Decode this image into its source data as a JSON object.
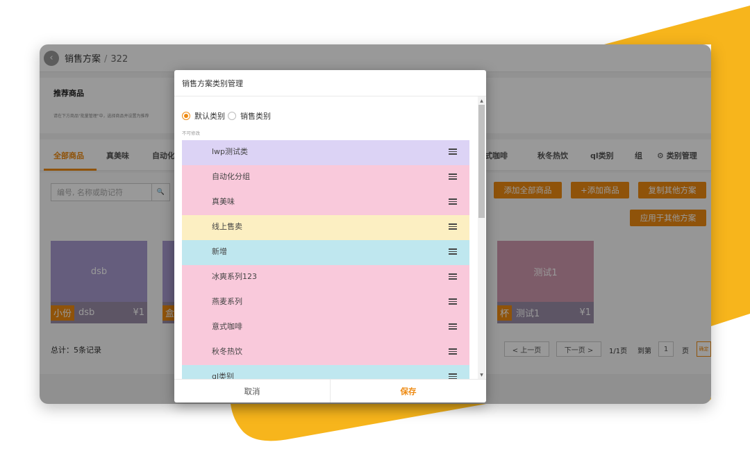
{
  "colors": {
    "accent": "#ee8a12",
    "decor_yellow": "#f7b51c",
    "row_purple": "#dcd3f5",
    "row_pink": "#f9c9db",
    "row_yellow": "#fcefc2",
    "row_cyan": "#bfe7ef"
  },
  "header": {
    "breadcrumb_parent": "销售方案",
    "breadcrumb_separator": "/",
    "breadcrumb_current": "322",
    "back_icon": "chevron-left-icon"
  },
  "recommend": {
    "title": "推荐商品",
    "description": "请在下方商品\"批量管理\"中，选择商品并设置为推荐"
  },
  "tabs": [
    {
      "label": "全部商品"
    },
    {
      "label": "真美味"
    },
    {
      "label": "自动化"
    },
    {
      "label": "意式咖啡"
    },
    {
      "label": "秋冬热饮"
    },
    {
      "label": "ql类别"
    },
    {
      "label": "组"
    },
    {
      "label": "类别管理"
    }
  ],
  "search": {
    "placeholder": "编号, 名称或助记符",
    "icon": "search-icon"
  },
  "actions": {
    "add_all": "添加全部商品",
    "add_product": "+添加商品",
    "copy_other": "复制其他方案",
    "apply_other": "应用于其他方案"
  },
  "cards": [
    {
      "image_text": "dsb",
      "tag": "小份",
      "name": "dsb",
      "price": "¥1",
      "color": "#a89bd0"
    },
    {
      "image_text": "",
      "tag": "盒",
      "name": "",
      "price": "",
      "color": "#a89bd0"
    },
    {
      "image_text": "测试1",
      "tag": "杯",
      "name": "测试1",
      "price": "¥1",
      "color": "#d19aaf"
    }
  ],
  "footer": {
    "total": "总计：5条记录",
    "prev": "< 上一页",
    "next": "下一页 >",
    "page_info": "1/1页",
    "goto": "到第",
    "page_value": "1",
    "page_unit": "页",
    "confirm": "确定"
  },
  "modal": {
    "title": "销售方案类别管理",
    "radio_default": "默认类别",
    "radio_sales": "销售类别",
    "selected_radio": "default",
    "hint": "不可修改",
    "cancel": "取消",
    "save": "保存",
    "categories": [
      {
        "label": "lwp测试类",
        "color": "#dcd3f5"
      },
      {
        "label": "自动化分组",
        "color": "#f9c9db"
      },
      {
        "label": "真美味",
        "color": "#f9c9db"
      },
      {
        "label": "线上售卖",
        "color": "#fcefc2"
      },
      {
        "label": "新增",
        "color": "#bfe7ef"
      },
      {
        "label": "冰爽系列123",
        "color": "#f9c9db"
      },
      {
        "label": "燕麦系列",
        "color": "#f9c9db"
      },
      {
        "label": "意式咖啡",
        "color": "#f9c9db"
      },
      {
        "label": "秋冬热饮",
        "color": "#f9c9db"
      },
      {
        "label": "ql类别",
        "color": "#bfe7ef"
      }
    ]
  }
}
